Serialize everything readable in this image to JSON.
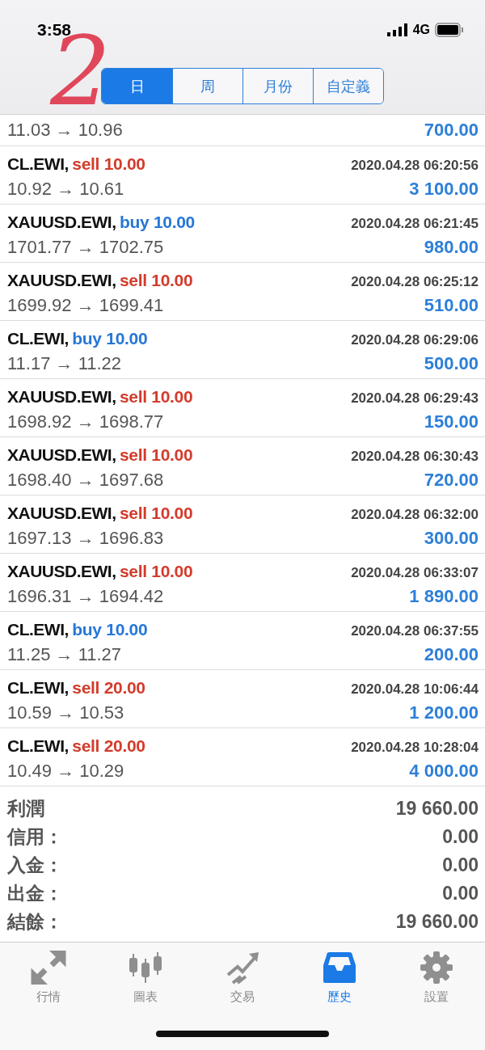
{
  "status_bar": {
    "time": "3:58",
    "network": "4G"
  },
  "annotation": {
    "text": "2",
    "color": "#e0475a"
  },
  "segments": [
    {
      "label": "日",
      "selected": true
    },
    {
      "label": "周",
      "selected": false
    },
    {
      "label": "月份",
      "selected": false
    },
    {
      "label": "自定義",
      "selected": false
    }
  ],
  "partial_row": {
    "prices": "11.03 → 10.96",
    "profit": "700.00"
  },
  "trades": [
    {
      "symbol": "CL.EWI,",
      "side": "sell",
      "volume": "10.00",
      "time": "2020.04.28 06:20:56",
      "prices": "10.92 → 10.61",
      "profit": "3 100.00"
    },
    {
      "symbol": "XAUUSD.EWI,",
      "side": "buy",
      "volume": "10.00",
      "time": "2020.04.28 06:21:45",
      "prices": "1701.77 → 1702.75",
      "profit": "980.00"
    },
    {
      "symbol": "XAUUSD.EWI,",
      "side": "sell",
      "volume": "10.00",
      "time": "2020.04.28 06:25:12",
      "prices": "1699.92 → 1699.41",
      "profit": "510.00"
    },
    {
      "symbol": "CL.EWI,",
      "side": "buy",
      "volume": "10.00",
      "time": "2020.04.28 06:29:06",
      "prices": "11.17 → 11.22",
      "profit": "500.00"
    },
    {
      "symbol": "XAUUSD.EWI,",
      "side": "sell",
      "volume": "10.00",
      "time": "2020.04.28 06:29:43",
      "prices": "1698.92 → 1698.77",
      "profit": "150.00"
    },
    {
      "symbol": "XAUUSD.EWI,",
      "side": "sell",
      "volume": "10.00",
      "time": "2020.04.28 06:30:43",
      "prices": "1698.40 → 1697.68",
      "profit": "720.00"
    },
    {
      "symbol": "XAUUSD.EWI,",
      "side": "sell",
      "volume": "10.00",
      "time": "2020.04.28 06:32:00",
      "prices": "1697.13 → 1696.83",
      "profit": "300.00"
    },
    {
      "symbol": "XAUUSD.EWI,",
      "side": "sell",
      "volume": "10.00",
      "time": "2020.04.28 06:33:07",
      "prices": "1696.31 → 1694.42",
      "profit": "1 890.00"
    },
    {
      "symbol": "CL.EWI,",
      "side": "buy",
      "volume": "10.00",
      "time": "2020.04.28 06:37:55",
      "prices": "11.25 → 11.27",
      "profit": "200.00"
    },
    {
      "symbol": "CL.EWI,",
      "side": "sell",
      "volume": "20.00",
      "time": "2020.04.28 10:06:44",
      "prices": "10.59 → 10.53",
      "profit": "1 200.00"
    },
    {
      "symbol": "CL.EWI,",
      "side": "sell",
      "volume": "20.00",
      "time": "2020.04.28 10:28:04",
      "prices": "10.49 → 10.29",
      "profit": "4 000.00"
    }
  ],
  "summary": [
    {
      "label": "利潤",
      "value": "19 660.00"
    },
    {
      "label": "信用：",
      "value": "0.00"
    },
    {
      "label": "入金：",
      "value": "0.00"
    },
    {
      "label": "出金：",
      "value": "0.00"
    },
    {
      "label": "結餘：",
      "value": "19 660.00"
    }
  ],
  "tab_bar": [
    {
      "label": "行情",
      "kind": "quotes",
      "selected": false
    },
    {
      "label": "圖表",
      "kind": "chart",
      "selected": false
    },
    {
      "label": "交易",
      "kind": "trade",
      "selected": false
    },
    {
      "label": "歷史",
      "kind": "history",
      "selected": true
    },
    {
      "label": "設置",
      "kind": "settings",
      "selected": false
    }
  ]
}
